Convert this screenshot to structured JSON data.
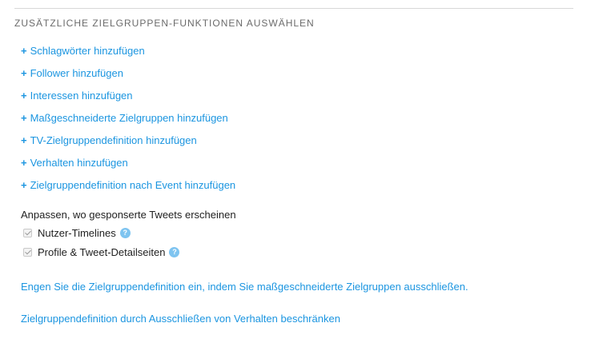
{
  "section": {
    "title": "ZUSÄTZLICHE ZIELGRUPPEN-FUNKTIONEN AUSWÄHLEN"
  },
  "add_links": [
    {
      "plus": "+",
      "label": "Schlagwörter hinzufügen"
    },
    {
      "plus": "+",
      "label": "Follower hinzufügen"
    },
    {
      "plus": "+",
      "label": "Interessen hinzufügen"
    },
    {
      "plus": "+",
      "label": "Maßgeschneiderte Zielgruppen hinzufügen"
    },
    {
      "plus": "+",
      "label": "TV-Zielgruppendefinition hinzufügen"
    },
    {
      "plus": "+",
      "label": "Verhalten hinzufügen"
    },
    {
      "plus": "+",
      "label": "Zielgruppendefinition nach Event hinzufügen"
    }
  ],
  "placement": {
    "heading": "Anpassen, wo gesponserte Tweets erscheinen",
    "options": [
      {
        "label": "Nutzer-Timelines",
        "checked": true,
        "disabled": true,
        "help": "?"
      },
      {
        "label": "Profile & Tweet-Detailseiten",
        "checked": true,
        "disabled": true,
        "help": "?"
      }
    ]
  },
  "links": {
    "exclude_tailored": "Engen Sie die Zielgruppendefinition ein, indem Sie maßgeschneiderte Zielgruppen ausschließen.",
    "exclude_behavior": "Zielgruppendefinition durch Ausschließen von Verhalten beschränken"
  },
  "colors": {
    "link": "#1b95e0",
    "help_icon": "#7ec4f0",
    "divider": "#d8d8d8"
  }
}
